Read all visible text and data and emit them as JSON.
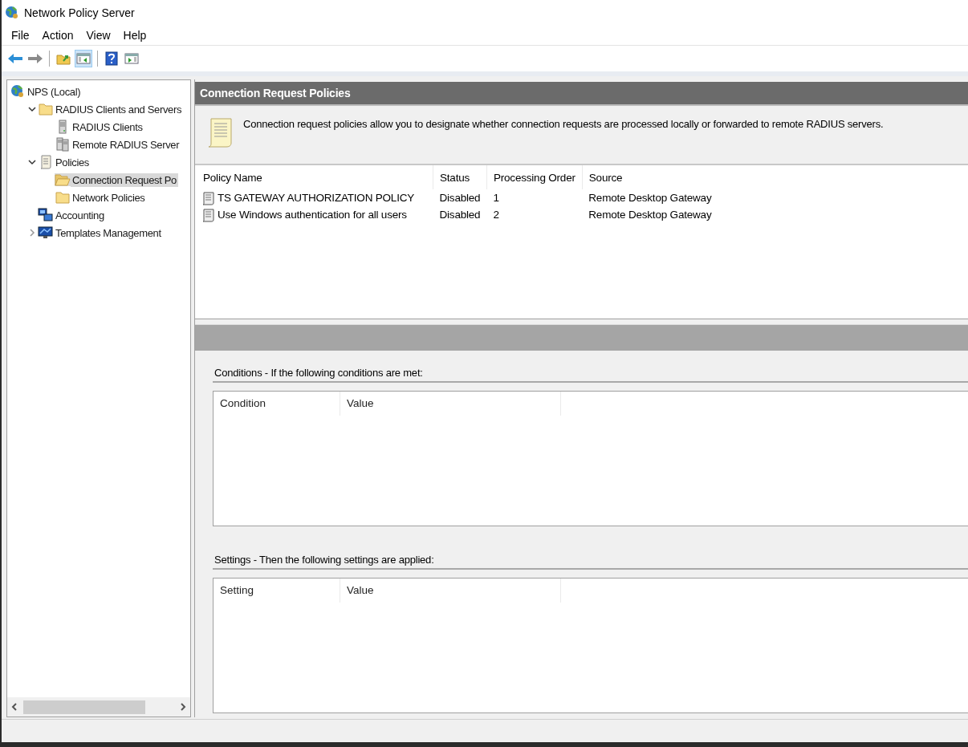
{
  "window": {
    "title": "Network Policy Server"
  },
  "menu": [
    "File",
    "Action",
    "View",
    "Help"
  ],
  "toolbar": [
    {
      "kind": "back",
      "selected": false
    },
    {
      "kind": "forward",
      "selected": false
    },
    {
      "kind": "sep"
    },
    {
      "kind": "up",
      "selected": false
    },
    {
      "kind": "tree-toggle",
      "selected": true
    },
    {
      "kind": "sep"
    },
    {
      "kind": "help",
      "selected": false
    },
    {
      "kind": "action-pane",
      "selected": false
    }
  ],
  "tree": [
    {
      "label": "NPS (Local)",
      "kind": "globe",
      "selected": false,
      "children": [
        {
          "label": "RADIUS Clients and Servers",
          "kind": "folder",
          "selected": false,
          "expanded": true,
          "children": [
            {
              "label": "RADIUS Clients",
              "kind": "server",
              "selected": false
            },
            {
              "label": "Remote RADIUS Server",
              "kind": "servers",
              "selected": false
            }
          ]
        },
        {
          "label": "Policies",
          "kind": "scroll",
          "selected": false,
          "expanded": true,
          "children": [
            {
              "label": "Connection Request Po",
              "kind": "folder-open",
              "selected": true
            },
            {
              "label": "Network Policies",
              "kind": "folder",
              "selected": false
            }
          ]
        },
        {
          "label": "Accounting",
          "kind": "accounting",
          "selected": false
        },
        {
          "label": "Templates Management",
          "kind": "monitor",
          "selected": false,
          "expanded": false
        }
      ]
    }
  ],
  "panel": {
    "title": "Connection Request Policies",
    "description": "Connection request policies allow you to designate whether connection requests are processed locally or forwarded to remote RADIUS servers.",
    "columns": [
      "Policy Name",
      "Status",
      "Processing Order",
      "Source"
    ],
    "rows": [
      {
        "cells": [
          "TS GATEWAY AUTHORIZATION POLICY",
          "Disabled",
          "1",
          "Remote Desktop Gateway"
        ]
      },
      {
        "cells": [
          "Use Windows authentication for all users",
          "Disabled",
          "2",
          "Remote Desktop Gateway"
        ]
      }
    ]
  },
  "conditions": {
    "label": "Conditions - If the following conditions are met:",
    "columns": [
      "Condition",
      "Value"
    ]
  },
  "settings": {
    "label": "Settings - Then the following settings are applied:",
    "columns": [
      "Setting",
      "Value"
    ]
  }
}
